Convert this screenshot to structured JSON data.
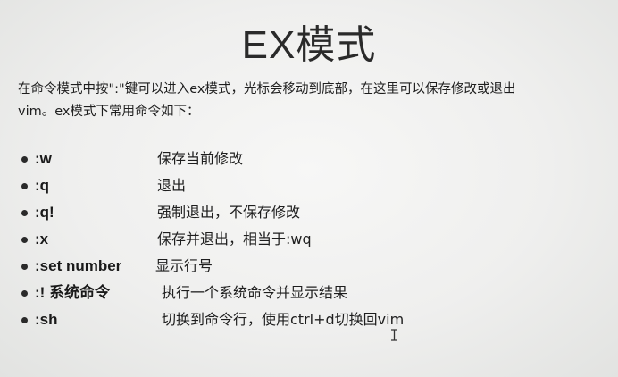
{
  "slide": {
    "title": "EX模式",
    "intro": [
      "在命令模式中按\":\"键可以进入ex模式，光标会移动到底部，在这里可以保存修改或退出",
      "vim。ex模式下常用命令如下："
    ],
    "commands": [
      {
        "cmd": ":w",
        "desc": "保存当前修改"
      },
      {
        "cmd": ":q",
        "desc": "退出"
      },
      {
        "cmd": ":q!",
        "desc": "强制退出，不保存修改"
      },
      {
        "cmd": ":x",
        "desc": "保存并退出，相当于:wq"
      },
      {
        "cmd": ":set number",
        "desc": "显示行号"
      },
      {
        "cmd": ":! 系统命令",
        "desc": "执行一个系统命令并显示结果"
      },
      {
        "cmd": ":sh",
        "desc": "切换到命令行，使用ctrl+d切换回vim"
      }
    ]
  },
  "colors": {
    "background": "#efefee",
    "text": "#1e1e1e"
  },
  "icons": {
    "bullet": "filled-circle",
    "cursor": "i-beam-cursor"
  }
}
